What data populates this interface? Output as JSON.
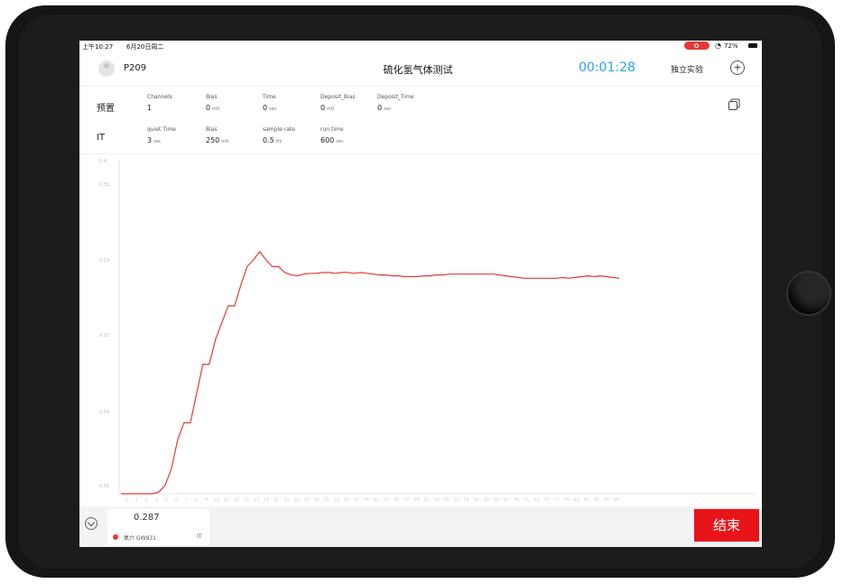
{
  "status_bar": {
    "time": "上午10:27",
    "date": "6月20日周二",
    "battery": "72%"
  },
  "header": {
    "device": "P209",
    "title": "硫化氢气体测试",
    "timer": "00:01:28",
    "standalone": "独立实验"
  },
  "params": {
    "row1": {
      "label": "预置",
      "items": [
        {
          "key": "Channels",
          "value": "1",
          "unit": ""
        },
        {
          "key": "Bias",
          "value": "0",
          "unit": "mV"
        },
        {
          "key": "Time",
          "value": "0",
          "unit": "sec"
        },
        {
          "key": "Deposit_Bias",
          "value": "0",
          "unit": "mV"
        },
        {
          "key": "Deposit_Time",
          "value": "0",
          "unit": "sec"
        }
      ]
    },
    "row2": {
      "label": "IT",
      "items": [
        {
          "key": "quiet Time",
          "value": "3",
          "unit": "sec"
        },
        {
          "key": "Bias",
          "value": "250",
          "unit": "mV"
        },
        {
          "key": "sample rate",
          "value": "0.5",
          "unit": "Hz"
        },
        {
          "key": "run time",
          "value": "600",
          "unit": "sec"
        }
      ]
    }
  },
  "chart_data": {
    "type": "line",
    "ylim": [
      0.0,
      0.4
    ],
    "y_ticks": [
      "0.4",
      "0.31",
      "0.23",
      "0.17",
      "0.09",
      "0.01"
    ],
    "x_ticks": [
      "1",
      "2",
      "3",
      "4",
      "5",
      "6",
      "7",
      "8",
      "9",
      "10",
      "11",
      "13",
      "15",
      "17",
      "19",
      "21",
      "23",
      "25",
      "27",
      "29",
      "31",
      "33",
      "35",
      "37",
      "39",
      "41",
      "43",
      "45",
      "47",
      "49",
      "51",
      "53",
      "55",
      "57",
      "59",
      "61",
      "63",
      "65",
      "67",
      "69",
      "71",
      "73",
      "75",
      "77",
      "79",
      "81",
      "83",
      "85",
      "87",
      "89"
    ],
    "color": "#e53935",
    "series": [
      {
        "values": [
          [
            1,
            0.0
          ],
          [
            2,
            0.0
          ],
          [
            3,
            0.0
          ],
          [
            4,
            0.0
          ],
          [
            5,
            0.0
          ],
          [
            6,
            0.0
          ],
          [
            7,
            0.002
          ],
          [
            8,
            0.01
          ],
          [
            9,
            0.03
          ],
          [
            10,
            0.065
          ],
          [
            11,
            0.085
          ],
          [
            12,
            0.085
          ],
          [
            13,
            0.12
          ],
          [
            14,
            0.155
          ],
          [
            15,
            0.155
          ],
          [
            16,
            0.185
          ],
          [
            17,
            0.205
          ],
          [
            18,
            0.225
          ],
          [
            19,
            0.225
          ],
          [
            20,
            0.25
          ],
          [
            21,
            0.272
          ],
          [
            22,
            0.28
          ],
          [
            23,
            0.29
          ],
          [
            24,
            0.28
          ],
          [
            25,
            0.272
          ],
          [
            26,
            0.272
          ],
          [
            27,
            0.265
          ],
          [
            28,
            0.262
          ],
          [
            29,
            0.261
          ],
          [
            30,
            0.263
          ],
          [
            31,
            0.264
          ],
          [
            32,
            0.264
          ],
          [
            33,
            0.265
          ],
          [
            34,
            0.265
          ],
          [
            35,
            0.264
          ],
          [
            36,
            0.265
          ],
          [
            37,
            0.265
          ],
          [
            38,
            0.264
          ],
          [
            39,
            0.265
          ],
          [
            40,
            0.264
          ],
          [
            41,
            0.263
          ],
          [
            42,
            0.262
          ],
          [
            43,
            0.262
          ],
          [
            44,
            0.261
          ],
          [
            45,
            0.261
          ],
          [
            46,
            0.26
          ],
          [
            47,
            0.26
          ],
          [
            48,
            0.26
          ],
          [
            49,
            0.261
          ],
          [
            50,
            0.261
          ],
          [
            51,
            0.262
          ],
          [
            52,
            0.262
          ],
          [
            53,
            0.263
          ],
          [
            54,
            0.263
          ],
          [
            55,
            0.263
          ],
          [
            56,
            0.263
          ],
          [
            57,
            0.263
          ],
          [
            58,
            0.263
          ],
          [
            59,
            0.263
          ],
          [
            60,
            0.263
          ],
          [
            61,
            0.262
          ],
          [
            62,
            0.261
          ],
          [
            63,
            0.26
          ],
          [
            64,
            0.259
          ],
          [
            65,
            0.258
          ],
          [
            66,
            0.258
          ],
          [
            67,
            0.258
          ],
          [
            68,
            0.258
          ],
          [
            69,
            0.258
          ],
          [
            70,
            0.258
          ],
          [
            71,
            0.259
          ],
          [
            72,
            0.258
          ],
          [
            73,
            0.259
          ],
          [
            74,
            0.26
          ],
          [
            75,
            0.261
          ],
          [
            76,
            0.26
          ],
          [
            77,
            0.261
          ],
          [
            78,
            0.26
          ],
          [
            79,
            0.259
          ],
          [
            80,
            0.258
          ]
        ]
      }
    ]
  },
  "bottom": {
    "value": "0.287",
    "channel_name": "氧六 GW831",
    "mode": "IT",
    "end_label": "结束"
  }
}
